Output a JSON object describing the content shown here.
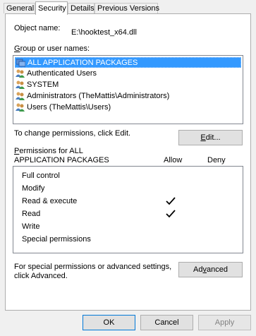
{
  "tabs": [
    "General",
    "Security",
    "Details",
    "Previous Versions"
  ],
  "active_tab": "Security",
  "object_name_label": "Object name:",
  "object_name_value": "E:\\hooktest_x64.dll",
  "group_label": "Group or user names:",
  "groups": [
    {
      "name": "ALL APPLICATION PACKAGES",
      "icon": "app-packages-icon",
      "selected": true
    },
    {
      "name": "Authenticated Users",
      "icon": "users-group-icon",
      "selected": false
    },
    {
      "name": "SYSTEM",
      "icon": "users-group-icon",
      "selected": false
    },
    {
      "name": "Administrators (TheMattis\\Administrators)",
      "icon": "users-group-icon",
      "selected": false
    },
    {
      "name": "Users (TheMattis\\Users)",
      "icon": "users-group-icon",
      "selected": false
    }
  ],
  "change_perm_text": "To change permissions, click Edit.",
  "edit_button": "Edit...",
  "permissions_for_line1": "Permissions for ALL",
  "permissions_for_line2": "APPLICATION PACKAGES",
  "allow_header": "Allow",
  "deny_header": "Deny",
  "permissions": [
    {
      "name": "Full control",
      "allow": false,
      "deny": false
    },
    {
      "name": "Modify",
      "allow": false,
      "deny": false
    },
    {
      "name": "Read & execute",
      "allow": true,
      "deny": false
    },
    {
      "name": "Read",
      "allow": true,
      "deny": false
    },
    {
      "name": "Write",
      "allow": false,
      "deny": false
    },
    {
      "name": "Special permissions",
      "allow": false,
      "deny": false
    }
  ],
  "advanced_text_line1": "For special permissions or advanced settings,",
  "advanced_text_line2": "click Advanced.",
  "advanced_button": "Advanced",
  "ok_button": "OK",
  "cancel_button": "Cancel",
  "apply_button": "Apply",
  "colors": {
    "selection": "#3399ff",
    "window_bg": "#f0f0f0",
    "panel_bg": "#ffffff",
    "default_button_border": "#0078d7"
  }
}
